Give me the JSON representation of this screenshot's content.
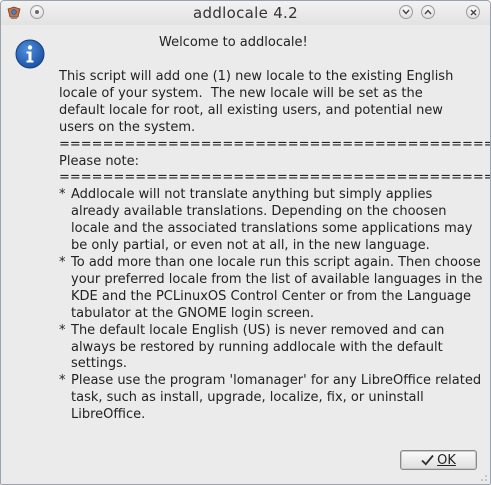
{
  "window": {
    "title": "addlocale 4.2"
  },
  "titlebar_buttons": {
    "menu_icon": "app-menu-icon",
    "sticky_icon": "on-all-desktops-icon",
    "minimize_icon": "chevron-down-icon",
    "maximize_icon": "chevron-up-icon",
    "close_icon": "close-icon"
  },
  "dialog": {
    "icon": "info-icon",
    "heading": "Welcome to addlocale!",
    "intro_lines": [
      "This script will add one (1) new locale to the existing English",
      "locale of your system.  The new locale will be set as the",
      "default locale for root, all existing users, and potential new",
      "users on the system."
    ],
    "separator1": "========================================",
    "note_label": "Please note:",
    "separator2": "========================================",
    "bullets": [
      "Addlocale will not translate anything but simply applies already available translations. Depending on the choosen locale and the associated translations some applications may be only partial, or even not at all, in the new language.",
      "To add more than one locale run this script again. Then choose your preferred locale from the list of available languages in the KDE and the PCLinuxOS Control Center or from the Language tabulator at the GNOME login screen.",
      "The default locale English (US) is never removed and can always be restored by running addlocale with the default settings.",
      "Please use the program 'lomanager' for any LibreOffice related task, such as install, upgrade, localize, fix, or uninstall LibreOffice."
    ],
    "bullet_marker": "*"
  },
  "buttons": {
    "ok_label": "OK",
    "ok_icon": "checkmark-icon"
  }
}
